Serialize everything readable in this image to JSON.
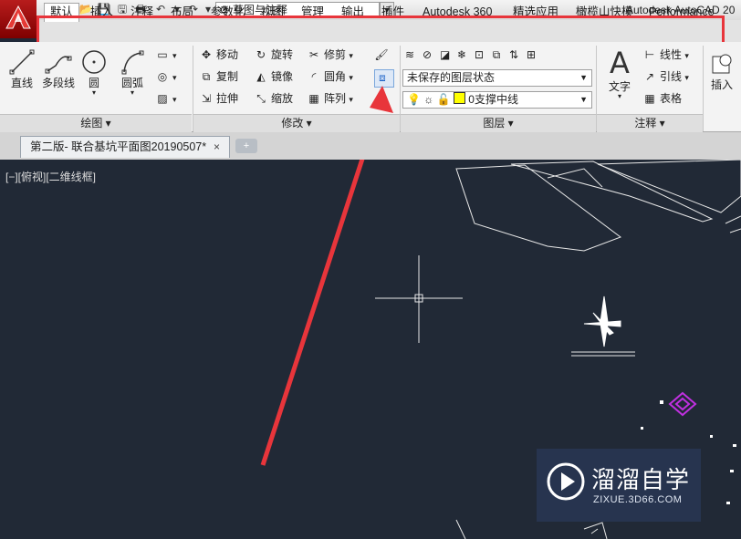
{
  "app": {
    "title": "Autodesk AutoCAD 20",
    "workspace": "草图与注释"
  },
  "ribbon_tabs": [
    "默认",
    "插入",
    "注释",
    "布局",
    "参数化",
    "视图",
    "管理",
    "输出",
    "插件",
    "Autodesk 360",
    "精选应用",
    "橄榄山快模",
    "Performance"
  ],
  "active_tab": "默认",
  "panels": {
    "draw": {
      "title": "绘图",
      "buttons": [
        "直线",
        "多段线",
        "圆",
        "圆弧"
      ]
    },
    "modify": {
      "title": "修改",
      "items": [
        "移动",
        "旋转",
        "修剪",
        "复制",
        "镜像",
        "圆角",
        "拉伸",
        "缩放",
        "阵列"
      ]
    },
    "layer": {
      "title": "图层",
      "state": "未保存的图层状态",
      "current": "0支撑中线"
    },
    "annotation": {
      "title": "注释",
      "text_button": "文字",
      "items": [
        "线性",
        "引线",
        "表格"
      ]
    },
    "insert": {
      "label": "插入"
    }
  },
  "file_tab": {
    "title": "第二版- 联合基坑平面图20190507*",
    "close": "×"
  },
  "viewport_label": "[−][俯视][二维线框]",
  "watermark": {
    "name": "溜溜自学",
    "url": "ZIXUE.3D66.COM"
  },
  "colors": {
    "canvas": "#212936",
    "highlight": "#e8353b",
    "drawing_lines": "#ffffff",
    "magenta": "#c030e0"
  }
}
